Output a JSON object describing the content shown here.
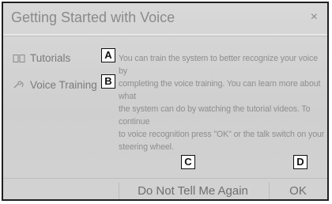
{
  "dialog": {
    "title": "Getting Started with Voice",
    "close_glyph": "×"
  },
  "sidebar": {
    "items": [
      {
        "label": "Tutorials",
        "icon": "book-icon"
      },
      {
        "label": "Voice Training",
        "icon": "voice-training-icon"
      }
    ]
  },
  "body": {
    "lines": [
      "You can train the system to better recognize your voice by",
      "completing the voice training. You can learn more about what",
      "the system can do by watching the tutorial videos. To continue",
      "to voice recognition press \"OK\" or the talk switch on your",
      "steering wheel."
    ]
  },
  "buttons": {
    "dont_tell": "Do Not Tell Me Again",
    "ok": "OK"
  },
  "callouts": {
    "a": "A",
    "b": "B",
    "c": "C",
    "d": "D"
  }
}
